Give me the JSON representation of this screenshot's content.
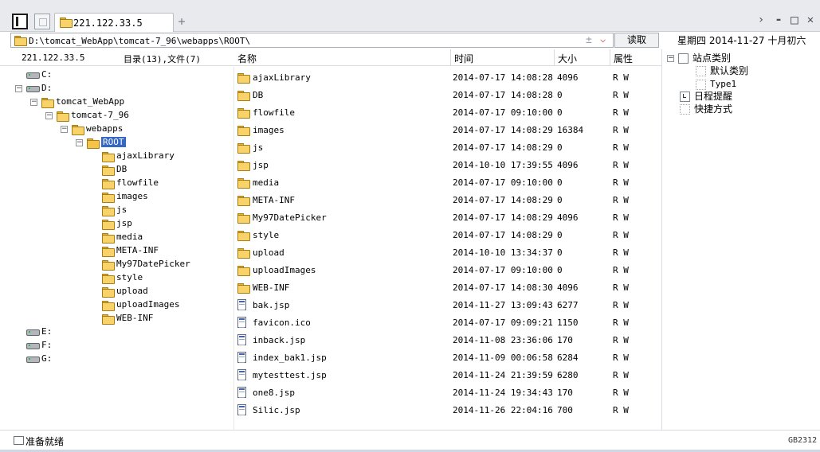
{
  "window": {
    "tab_title": "221.122.33.5",
    "new_tab_label": "+",
    "controls": {
      "chevron": "›",
      "minimize": "▬",
      "maximize": "□",
      "close": "✕"
    }
  },
  "address": {
    "path": "D:\\tomcat_WebApp\\tomcat-7_96\\webapps\\ROOT\\",
    "plus": "±",
    "dropdown": "⌵",
    "read_button": "读取",
    "datetime": "星期四 2014-11-27 十月初六"
  },
  "header": {
    "host": "221.122.33.5",
    "count": "目录(13),文件(7)",
    "columns": {
      "name": "名称",
      "time": "时间",
      "size": "大小",
      "attr": "属性"
    }
  },
  "tree": [
    {
      "label": "C:",
      "type": "drive",
      "exp": ""
    },
    {
      "label": "D:",
      "type": "drive",
      "exp": "−"
    },
    {
      "label": "tomcat_WebApp",
      "type": "folder",
      "exp": "−"
    },
    {
      "label": "tomcat-7_96",
      "type": "folder",
      "exp": "−"
    },
    {
      "label": "webapps",
      "type": "folder",
      "exp": "−"
    },
    {
      "label": "ROOT",
      "type": "folder",
      "exp": "−",
      "selected": true
    },
    {
      "label": "ajaxLibrary",
      "type": "folder",
      "exp": ""
    },
    {
      "label": "DB",
      "type": "folder",
      "exp": ""
    },
    {
      "label": "flowfile",
      "type": "folder",
      "exp": ""
    },
    {
      "label": "images",
      "type": "folder",
      "exp": ""
    },
    {
      "label": "js",
      "type": "folder",
      "exp": ""
    },
    {
      "label": "jsp",
      "type": "folder",
      "exp": ""
    },
    {
      "label": "media",
      "type": "folder",
      "exp": ""
    },
    {
      "label": "META-INF",
      "type": "folder",
      "exp": ""
    },
    {
      "label": "My97DatePicker",
      "type": "folder",
      "exp": ""
    },
    {
      "label": "style",
      "type": "folder",
      "exp": ""
    },
    {
      "label": "upload",
      "type": "folder",
      "exp": ""
    },
    {
      "label": "uploadImages",
      "type": "folder",
      "exp": ""
    },
    {
      "label": "WEB-INF",
      "type": "folder",
      "exp": ""
    },
    {
      "label": "E:",
      "type": "drive",
      "exp": ""
    },
    {
      "label": "F:",
      "type": "drive",
      "exp": ""
    },
    {
      "label": "G:",
      "type": "drive",
      "exp": ""
    }
  ],
  "files": [
    {
      "name": "ajaxLibrary",
      "time": "2014-07-17 14:08:28",
      "size": "4096",
      "attr": "R W",
      "type": "folder"
    },
    {
      "name": "DB",
      "time": "2014-07-17 14:08:28",
      "size": "0",
      "attr": "R W",
      "type": "folder"
    },
    {
      "name": "flowfile",
      "time": "2014-07-17 09:10:00",
      "size": "0",
      "attr": "R W",
      "type": "folder"
    },
    {
      "name": "images",
      "time": "2014-07-17 14:08:29",
      "size": "16384",
      "attr": "R W",
      "type": "folder"
    },
    {
      "name": "js",
      "time": "2014-07-17 14:08:29",
      "size": "0",
      "attr": "R W",
      "type": "folder"
    },
    {
      "name": "jsp",
      "time": "2014-10-10 17:39:55",
      "size": "4096",
      "attr": "R W",
      "type": "folder"
    },
    {
      "name": "media",
      "time": "2014-07-17 09:10:00",
      "size": "0",
      "attr": "R W",
      "type": "folder"
    },
    {
      "name": "META-INF",
      "time": "2014-07-17 14:08:29",
      "size": "0",
      "attr": "R W",
      "type": "folder"
    },
    {
      "name": "My97DatePicker",
      "time": "2014-07-17 14:08:29",
      "size": "4096",
      "attr": "R W",
      "type": "folder"
    },
    {
      "name": "style",
      "time": "2014-07-17 14:08:29",
      "size": "0",
      "attr": "R W",
      "type": "folder"
    },
    {
      "name": "upload",
      "time": "2014-10-10 13:34:37",
      "size": "0",
      "attr": "R W",
      "type": "folder"
    },
    {
      "name": "uploadImages",
      "time": "2014-07-17 09:10:00",
      "size": "0",
      "attr": "R W",
      "type": "folder"
    },
    {
      "name": "WEB-INF",
      "time": "2014-07-17 14:08:30",
      "size": "4096",
      "attr": "R W",
      "type": "folder"
    },
    {
      "name": "bak.jsp",
      "time": "2014-11-27 13:09:43",
      "size": "6277",
      "attr": "R W",
      "type": "file"
    },
    {
      "name": "favicon.ico",
      "time": "2014-07-17 09:09:21",
      "size": "1150",
      "attr": "R W",
      "type": "file"
    },
    {
      "name": "inback.jsp",
      "time": "2014-11-08 23:36:06",
      "size": "170",
      "attr": "R W",
      "type": "file"
    },
    {
      "name": "index_bak1.jsp",
      "time": "2014-11-09 00:06:58",
      "size": "6284",
      "attr": "R W",
      "type": "file"
    },
    {
      "name": "mytesttest.jsp",
      "time": "2014-11-24 21:39:59",
      "size": "6280",
      "attr": "R W",
      "type": "file"
    },
    {
      "name": "one8.jsp",
      "time": "2014-11-24 19:34:43",
      "size": "170",
      "attr": "R W",
      "type": "file"
    },
    {
      "name": "Silic.jsp",
      "time": "2014-11-26 22:04:16",
      "size": "700",
      "attr": "R W",
      "type": "file"
    }
  ],
  "right_panel": {
    "site_category": "站点类别",
    "default_category": "默认类别",
    "type1": "Type1",
    "schedule": "日程提醒",
    "shortcut": "快捷方式",
    "expand_sign": "−"
  },
  "status": {
    "text": "准备就绪",
    "encoding": "GB2312"
  }
}
